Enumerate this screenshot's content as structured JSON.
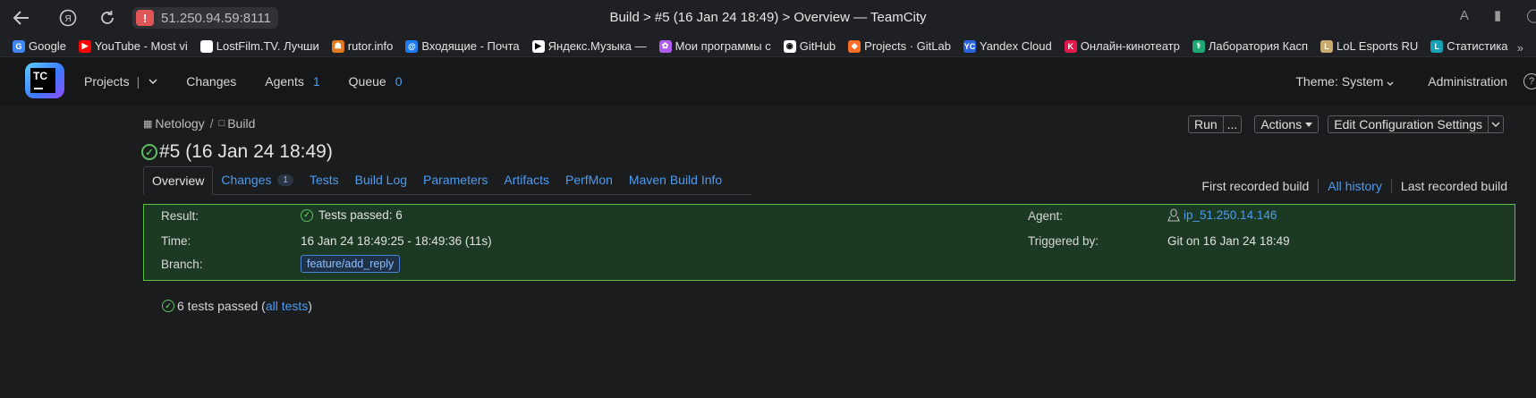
{
  "browser": {
    "address": "51.250.94.59:8111",
    "warning_symbol": "!",
    "page_title": "Build > #5 (16 Jan 24 18:49) > Overview — TeamCity",
    "bookmarks": [
      {
        "label": "Google",
        "color": "#4285f4",
        "icon": "G"
      },
      {
        "label": "YouTube - Most vi",
        "color": "#ff0000",
        "icon": "▶"
      },
      {
        "label": "LostFilm.TV. Лучши",
        "color": "#ffffff",
        "icon": ""
      },
      {
        "label": "rutor.info",
        "color": "#e37b1e",
        "icon": "☗"
      },
      {
        "label": "Входящие - Почта",
        "color": "#1f7cf0",
        "icon": "@"
      },
      {
        "label": "Яндекс.Музыка —",
        "color": "#ffffff",
        "icon": "▶"
      },
      {
        "label": "Мои программы с",
        "color": "#b05cf0",
        "icon": "✿"
      },
      {
        "label": "GitHub",
        "color": "#ffffff",
        "icon": "◉"
      },
      {
        "label": "Projects · GitLab",
        "color": "#fc6d26",
        "icon": "◆"
      },
      {
        "label": "Yandex Cloud",
        "color": "#2b63d9",
        "icon": "YC"
      },
      {
        "label": "Онлайн-кинотеатр",
        "color": "#e2184c",
        "icon": "K"
      },
      {
        "label": "Лаборатория Касп",
        "color": "#1ea876",
        "icon": "⚕"
      },
      {
        "label": "LoL Esports RU",
        "color": "#c8aa6e",
        "icon": "L"
      },
      {
        "label": "Статистика",
        "color": "#17a2b8",
        "icon": "L"
      }
    ]
  },
  "header": {
    "projects": "Projects",
    "changes": "Changes",
    "agents": "Agents",
    "agents_count": "1",
    "queue": "Queue",
    "queue_count": "0",
    "theme": "Theme: System",
    "administration": "Administration",
    "logo_text": "TC"
  },
  "breadcrumb": {
    "project": "Netology",
    "config": "Build"
  },
  "actions": {
    "run": "Run",
    "run_more": "...",
    "actions": "Actions",
    "edit": "Edit Configuration Settings"
  },
  "build": {
    "title": "#5 (16 Jan 24 18:49)"
  },
  "tabs": [
    {
      "label": "Overview"
    },
    {
      "label": "Changes",
      "badge": "1"
    },
    {
      "label": "Tests"
    },
    {
      "label": "Build Log"
    },
    {
      "label": "Parameters"
    },
    {
      "label": "Artifacts"
    },
    {
      "label": "PerfMon"
    },
    {
      "label": "Maven Build Info"
    }
  ],
  "history": {
    "first": "First recorded build",
    "all": "All history",
    "last": "Last recorded build"
  },
  "result": {
    "result_label": "Result:",
    "result_value": "Tests passed: 6",
    "time_label": "Time:",
    "time_value": "16 Jan 24 18:49:25 - 18:49:36 (11s)",
    "branch_label": "Branch:",
    "branch_value": "feature/add_reply",
    "agent_label": "Agent:",
    "agent_value": "ip_51.250.14.146",
    "triggered_label": "Triggered by:",
    "triggered_value": "Git on 16 Jan 24 18:49"
  },
  "summary": {
    "text": "6 tests passed (",
    "link": "all tests",
    "close": ")"
  },
  "colors": {
    "accent": "#4d9cf0",
    "success": "#5cbf63",
    "result_bg": "#1c3a23",
    "result_border": "#5dbf3e"
  }
}
